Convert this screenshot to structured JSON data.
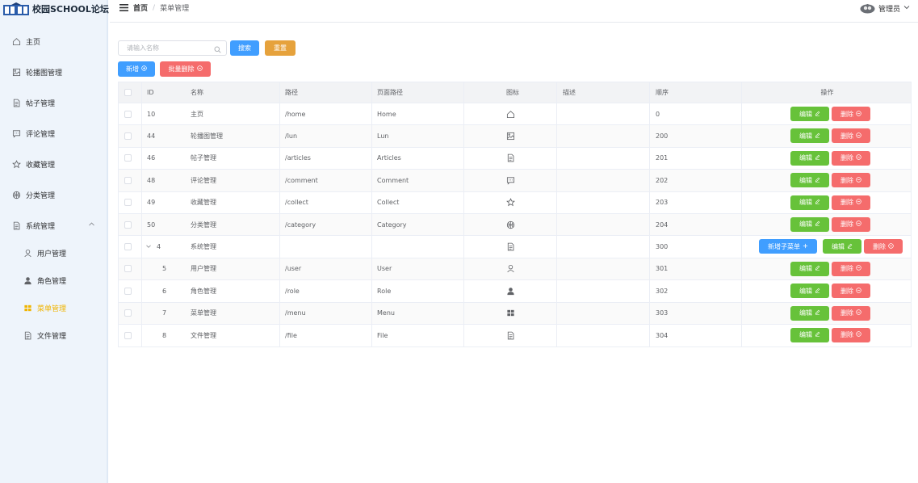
{
  "app": {
    "title": "校园SCHOOL论坛"
  },
  "sidebar": {
    "items": [
      {
        "label": "主页",
        "icon": "home-icon"
      },
      {
        "label": "轮播图管理",
        "icon": "picture-icon"
      },
      {
        "label": "帖子管理",
        "icon": "document-icon"
      },
      {
        "label": "评论管理",
        "icon": "chat-icon"
      },
      {
        "label": "收藏管理",
        "icon": "star-icon"
      },
      {
        "label": "分类管理",
        "icon": "basketball-icon"
      },
      {
        "label": "系统管理",
        "icon": "document-icon"
      }
    ],
    "sub_items": [
      {
        "label": "用户管理",
        "icon": "user-icon"
      },
      {
        "label": "角色管理",
        "icon": "user-solid-icon"
      },
      {
        "label": "菜单管理",
        "icon": "menu-grid-icon",
        "active": true
      },
      {
        "label": "文件管理",
        "icon": "document-icon"
      }
    ],
    "active_color": "#f0b400"
  },
  "header": {
    "breadcrumb_home": "首页",
    "breadcrumb_sep": "/",
    "breadcrumb_current": "菜单管理",
    "user_name": "管理员"
  },
  "toolbar": {
    "search_placeholder": "请输入名称",
    "search_label": "搜索",
    "reset_label": "重置",
    "add_label": "新增",
    "batch_delete_label": "批量删除"
  },
  "table": {
    "headers": [
      "ID",
      "名称",
      "路径",
      "页面路径",
      "图标",
      "描述",
      "顺序",
      "操作"
    ],
    "edit_label": "编辑",
    "delete_label": "删除",
    "add_child_label": "新增子菜单",
    "rows": [
      {
        "id": "10",
        "name": "主页",
        "path": "/home",
        "page": "Home",
        "icon": "home-icon",
        "desc": "",
        "order": "0"
      },
      {
        "id": "44",
        "name": "轮播图管理",
        "path": "/lun",
        "page": "Lun",
        "icon": "picture-icon",
        "desc": "",
        "order": "200"
      },
      {
        "id": "46",
        "name": "帖子管理",
        "path": "/articles",
        "page": "Articles",
        "icon": "document-icon",
        "desc": "",
        "order": "201"
      },
      {
        "id": "48",
        "name": "评论管理",
        "path": "/comment",
        "page": "Comment",
        "icon": "chat-icon",
        "desc": "",
        "order": "202"
      },
      {
        "id": "49",
        "name": "收藏管理",
        "path": "/collect",
        "page": "Collect",
        "icon": "star-icon",
        "desc": "",
        "order": "203"
      },
      {
        "id": "50",
        "name": "分类管理",
        "path": "/category",
        "page": "Category",
        "icon": "basketball-icon",
        "desc": "",
        "order": "204"
      },
      {
        "id": "4",
        "name": "系统管理",
        "path": "",
        "page": "",
        "icon": "document-icon",
        "desc": "",
        "order": "300",
        "parent": true
      },
      {
        "id": "5",
        "name": "用户管理",
        "path": "/user",
        "page": "User",
        "icon": "user-icon",
        "desc": "",
        "order": "301",
        "child": true
      },
      {
        "id": "6",
        "name": "角色管理",
        "path": "/role",
        "page": "Role",
        "icon": "user-solid-icon",
        "desc": "",
        "order": "302",
        "child": true
      },
      {
        "id": "7",
        "name": "菜单管理",
        "path": "/menu",
        "page": "Menu",
        "icon": "menu-grid-icon",
        "desc": "",
        "order": "303",
        "child": true
      },
      {
        "id": "8",
        "name": "文件管理",
        "path": "/file",
        "page": "File",
        "icon": "document-icon",
        "desc": "",
        "order": "304",
        "child": true
      }
    ]
  },
  "colors": {
    "primary": "#409eff",
    "success": "#67c23a",
    "danger": "#f56c6c",
    "warning": "#e6a23c"
  }
}
